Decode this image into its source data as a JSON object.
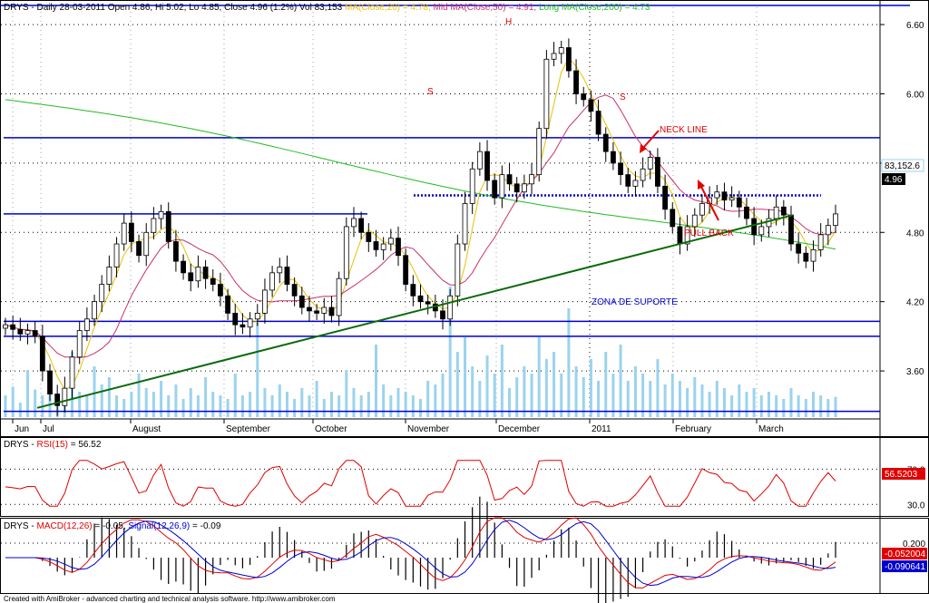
{
  "footer": "Created with AmiBroker - advanced charting and technical analysis software. http://www.amibroker.com",
  "colors": {
    "ma20": "#e6c200",
    "ma50": "#c8326e",
    "ma200": "#22bb22",
    "levels": "#0000cc",
    "trend": "#0a6a0a",
    "volume": "#9bd3ee",
    "rsi": "#e00000",
    "macd": "#e00000",
    "signal": "#0000cc",
    "annotation": "#e00000"
  },
  "price_panel": {
    "header": {
      "symbol": "DRYS",
      "info": " - Daily 28-03-2011 Open 4.86, Hi 5.02, Lo 4.85, Close 4.96 (1.2%) Vol 83,153 ",
      "ma20": "MA(Close,20) = 4.78,",
      "ma50": " Mid MA(Close,50) = 4.91,",
      "ma200": " Long MA(Close,200) = 4.73"
    },
    "annotations": {
      "s1": "S",
      "h": "H",
      "s2": "S",
      "neck": "NECK LINE",
      "pull": "PULL BACK",
      "zona": "ZONA DE SUPORTE"
    },
    "value_tags": {
      "volume": "83,152.6",
      "close": "4.96"
    }
  },
  "rsi_panel": {
    "symbol": "DRYS",
    "title": "RSI(15)",
    "value": " = 56.52",
    "tag": "56.5203"
  },
  "macd_panel": {
    "symbol": "DRYS",
    "macd_title": "MACD(12,26)",
    "macd_value": " = -0.05, ",
    "signal_title": "Signal(12,26,9)",
    "signal_value": " = -0.09",
    "tag_macd": "-0.052004",
    "tag_signal": "-0.090641"
  },
  "chart_data": {
    "type": "candlestick",
    "symbol": "DRYS",
    "x_months": [
      "Jun",
      "Jul",
      "August",
      "September",
      "October",
      "November",
      "December",
      "2011",
      "February",
      "March"
    ],
    "y_ticks": [
      3.6,
      4.2,
      4.8,
      5.4,
      6.0,
      6.6
    ],
    "ylim": [
      3.2,
      6.75
    ],
    "horizontal_levels": [
      5.62,
      4.96,
      4.03,
      3.9,
      3.25
    ],
    "neckline": 5.12,
    "trendline": {
      "from": {
        "month": "Jul",
        "price": 3.28
      },
      "to": {
        "month": "March",
        "price": 4.95
      }
    },
    "close_series": [
      4.0,
      3.96,
      3.92,
      3.95,
      3.9,
      3.6,
      3.4,
      3.3,
      3.45,
      3.72,
      3.95,
      4.05,
      4.2,
      4.35,
      4.5,
      4.7,
      4.88,
      4.72,
      4.6,
      4.8,
      4.92,
      4.98,
      4.72,
      4.55,
      4.45,
      4.38,
      4.5,
      4.4,
      4.35,
      4.25,
      4.1,
      4.0,
      3.98,
      4.05,
      4.1,
      4.3,
      4.45,
      4.5,
      4.35,
      4.25,
      4.15,
      4.12,
      4.1,
      4.15,
      4.08,
      4.4,
      4.85,
      4.92,
      4.8,
      4.72,
      4.65,
      4.7,
      4.75,
      4.6,
      4.35,
      4.25,
      4.2,
      4.18,
      4.12,
      4.05,
      4.25,
      4.7,
      5.05,
      5.35,
      5.5,
      5.25,
      5.1,
      5.3,
      5.22,
      5.15,
      5.22,
      5.3,
      5.7,
      6.3,
      6.35,
      6.4,
      6.2,
      6.0,
      5.95,
      5.85,
      5.65,
      5.5,
      5.4,
      5.3,
      5.2,
      5.25,
      5.35,
      5.45,
      5.2,
      5.0,
      4.85,
      4.7,
      4.85,
      4.95,
      5.05,
      5.1,
      5.15,
      5.08,
      5.1,
      5.02,
      4.92,
      4.78,
      4.85,
      4.92,
      5.02,
      4.95,
      4.7,
      4.62,
      4.55,
      4.65,
      4.78,
      4.86,
      4.96
    ],
    "volume_relative": [
      0.3,
      0.42,
      0.2,
      0.65,
      0.38,
      0.3,
      0.55,
      0.28,
      0.4,
      0.9,
      0.35,
      0.3,
      0.7,
      0.45,
      0.55,
      0.3,
      0.25,
      0.35,
      0.6,
      0.4,
      0.35,
      0.5,
      0.3,
      0.45,
      0.25,
      0.4,
      0.3,
      0.55,
      0.35,
      0.3,
      0.25,
      0.6,
      0.3,
      0.35,
      1.3,
      0.4,
      0.3,
      0.45,
      0.35,
      0.25,
      0.4,
      0.3,
      0.5,
      0.25,
      0.35,
      0.3,
      0.65,
      0.4,
      0.3,
      0.35,
      1.0,
      0.45,
      0.3,
      0.4,
      0.35,
      0.3,
      0.25,
      0.5,
      0.45,
      0.6,
      1.8,
      0.9,
      1.1,
      0.7,
      0.5,
      0.85,
      0.6,
      1.0,
      0.4,
      0.55,
      0.7,
      0.6,
      1.1,
      0.8,
      0.9,
      0.6,
      1.5,
      0.7,
      0.55,
      0.8,
      0.5,
      0.9,
      0.6,
      1.0,
      0.5,
      0.7,
      0.6,
      0.5,
      0.8,
      0.45,
      0.6,
      0.5,
      0.4,
      0.55,
      0.45,
      0.35,
      0.5,
      0.4,
      0.3,
      0.45,
      0.35,
      0.4,
      0.3,
      0.35,
      0.3,
      0.25,
      0.4,
      0.3,
      0.25,
      0.35,
      0.3,
      0.25,
      0.28
    ],
    "ma_series": [
      {
        "name": "MA(Close,20)",
        "value": 4.78
      },
      {
        "name": "Mid MA(Close,50)",
        "value": 4.91
      },
      {
        "name": "Long MA(Close,200)",
        "value": 4.73
      }
    ],
    "volume": 83153,
    "rsi": {
      "period": 15,
      "value": 56.52,
      "ticks": [
        30.0,
        70.0
      ]
    },
    "macd": {
      "fast": 12,
      "slow": 26,
      "signal": 9,
      "macd": -0.05,
      "signal_value": -0.09,
      "ticks": [
        0.2
      ]
    }
  }
}
